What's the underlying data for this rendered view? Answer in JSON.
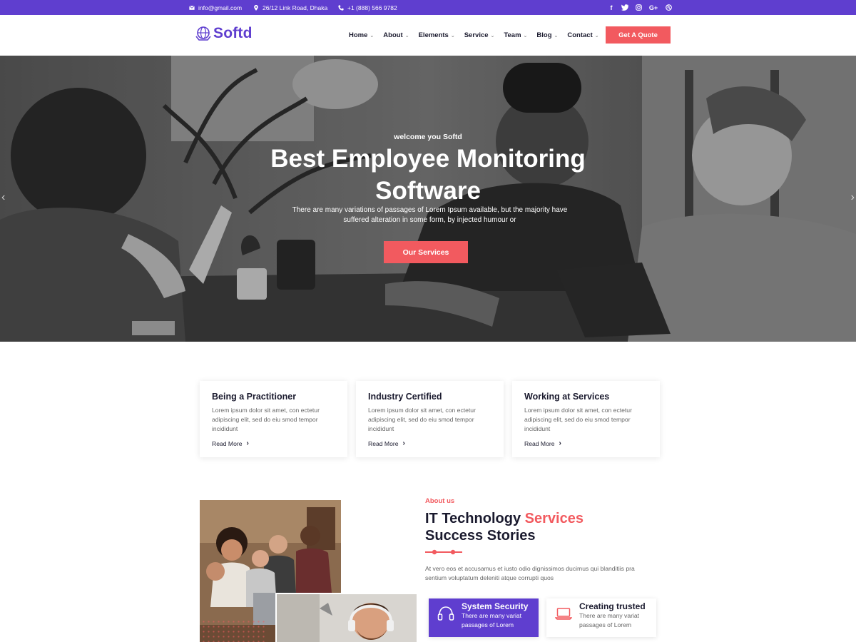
{
  "topbar": {
    "email": "info@gmail.com",
    "address": "26/12 Link Road, Dhaka",
    "phone": "+1 (888) 566 9782",
    "social": [
      "f",
      "t",
      "o",
      "G+",
      "d"
    ]
  },
  "navbar": {
    "logo": "Softd",
    "menu": [
      "Home",
      "About",
      "Elements",
      "Service",
      "Team",
      "Blog",
      "Contact"
    ],
    "quote_button": "Get A Quote"
  },
  "hero": {
    "subtitle": "welcome you Softd",
    "title_line1": "Best Employee Monitoring",
    "title_line2": "Software",
    "description": "There are many variations of passages of Lorem Ipsum available, but the majority have suffered alteration in some form, by injected humour or",
    "button": "Our Services",
    "arrow_left": "‹",
    "arrow_right": "›"
  },
  "features": [
    {
      "title": "Being a Practitioner",
      "text": "Lorem ipsum dolor sit amet, con ectetur adipiscing elit, sed do eiu smod tempor incididunt",
      "link": "Read More"
    },
    {
      "title": "Industry Certified",
      "text": "Lorem ipsum dolor sit amet, con ectetur adipiscing elit, sed do eiu smod tempor incididunt",
      "link": "Read More"
    },
    {
      "title": "Working at Services",
      "text": "Lorem ipsum dolor sit amet, con ectetur adipiscing elit, sed do eiu smod tempor incididunt",
      "link": "Read More"
    }
  ],
  "about": {
    "tag": "About us",
    "title_part1": "IT Technology ",
    "title_accent": "Services",
    "title_line2": "Success Stories",
    "description": "At vero eos et accusamus et iusto odio dignissimos ducimus qui blanditiis pra sentium voluptatum deleniti atque corrupti quos",
    "services": [
      {
        "title": "System Security",
        "text": "There are many variat passages of Lorem",
        "icon": "headset-icon"
      },
      {
        "title": "Creating trusted",
        "text": "There are many variat passages of Lorem",
        "icon": "laptop-icon"
      }
    ]
  },
  "colors": {
    "brand_purple": "#5f3ecf",
    "accent_red": "#f25a5f",
    "text_dark": "#1a1a2e"
  }
}
